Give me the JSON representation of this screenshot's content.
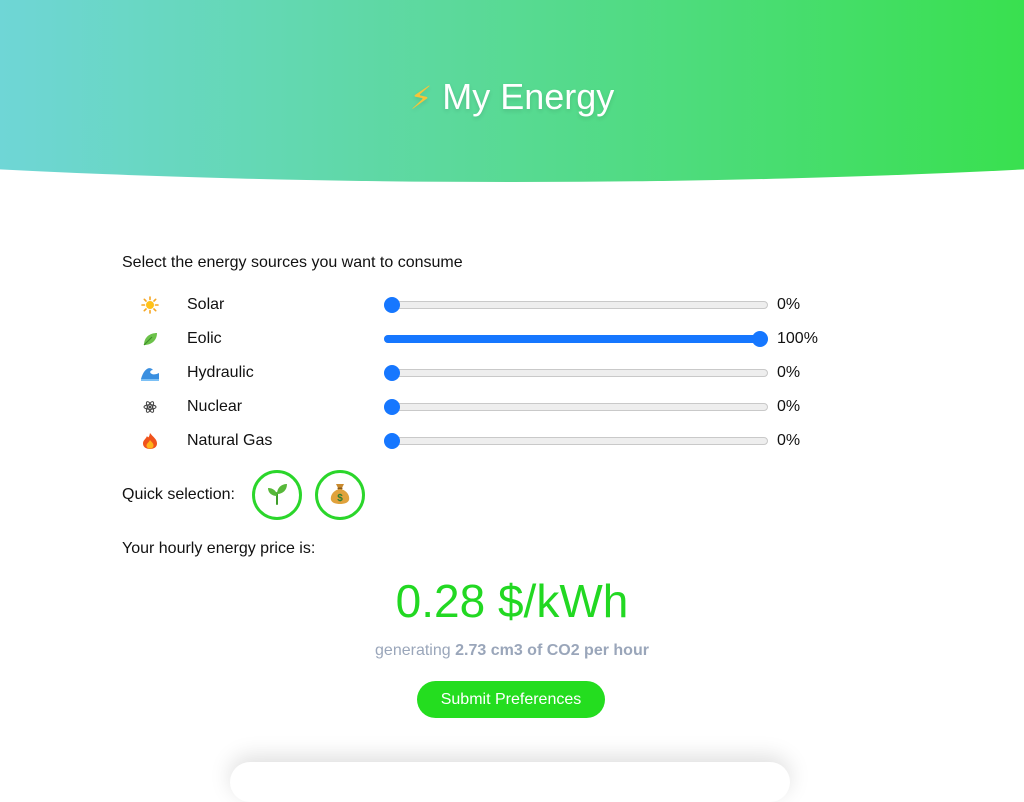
{
  "header": {
    "icon": "lightning-bolt-icon",
    "bolt_glyph": "⚡",
    "title": "My Energy"
  },
  "intro": "Select the energy sources you want to consume",
  "sources": [
    {
      "icon": "sun-icon",
      "label": "Solar",
      "value": 0,
      "percent_text": "0%"
    },
    {
      "icon": "leaf-icon",
      "label": "Eolic",
      "value": 100,
      "percent_text": "100%"
    },
    {
      "icon": "wave-icon",
      "label": "Hydraulic",
      "value": 0,
      "percent_text": "0%"
    },
    {
      "icon": "atom-icon",
      "label": "Nuclear",
      "value": 0,
      "percent_text": "0%"
    },
    {
      "icon": "fire-icon",
      "label": "Natural Gas",
      "value": 0,
      "percent_text": "0%"
    }
  ],
  "quick": {
    "label": "Quick selection:",
    "buttons": [
      {
        "icon": "seedling-icon"
      },
      {
        "icon": "money-bag-icon"
      }
    ]
  },
  "price": {
    "label": "Your hourly energy price is:",
    "value": "0.28 $/kWh",
    "co2_prefix": "generating",
    "co2_value": "2.73 cm3 of CO2 per hour"
  },
  "submit_label": "Submit Preferences",
  "colors": {
    "accent": "#1677ff",
    "green": "#22d822",
    "header_start": "#6fd6d6",
    "header_end": "#39e04f"
  }
}
